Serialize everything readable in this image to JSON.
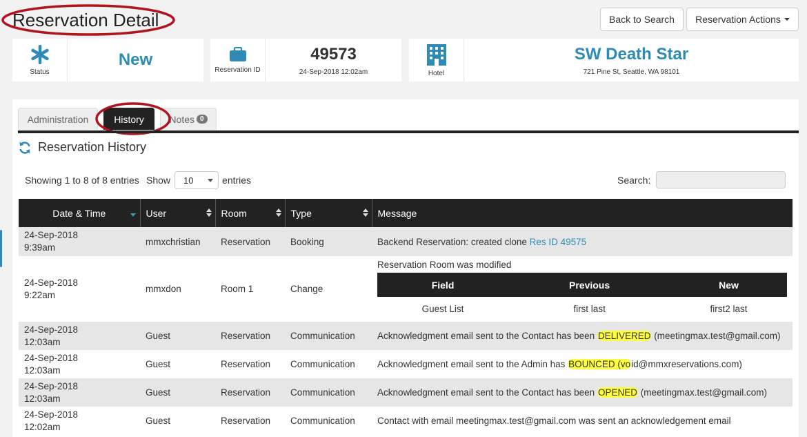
{
  "header": {
    "title": "Reservation Detail",
    "back_button": "Back to Search",
    "actions_button": "Reservation Actions"
  },
  "summary": {
    "status": {
      "caption": "Status",
      "value": "New",
      "icon": "asterisk-icon"
    },
    "reservation": {
      "caption": "Reservation ID",
      "value": "49573",
      "date": "24-Sep-2018 12:02am",
      "icon": "briefcase-icon"
    },
    "hotel": {
      "caption": "Hotel",
      "value": "SW Death Star",
      "address": "721 Pine St, Seattle, WA 98101",
      "icon": "building-icon"
    }
  },
  "tabs": {
    "administration": "Administration",
    "history": "History",
    "notes": "Notes",
    "notes_count": "0",
    "active": "History"
  },
  "history": {
    "title": "Reservation History",
    "showing": "Showing 1 to 8 of 8 entries",
    "show_label": "Show",
    "page_size": "10",
    "entries_label": "entries",
    "search_label": "Search:",
    "search_value": "",
    "columns": [
      "Date & Time",
      "User",
      "Room",
      "Type",
      "Message"
    ],
    "rows": [
      {
        "date": "24-Sep-2018",
        "time": "9:39am",
        "user": "mmxchristian",
        "room": "Reservation",
        "type": "Booking",
        "message_prefix": "Backend Reservation: created clone ",
        "message_link": "Res ID 49575"
      },
      {
        "date": "24-Sep-2018",
        "time": "9:22am",
        "user": "mmxdon",
        "room": "Room 1",
        "type": "Change",
        "message": "Reservation Room was modified",
        "changes": {
          "headers": [
            "Field",
            "Previous",
            "New"
          ],
          "row": [
            "Guest List",
            "first last",
            "first2 last"
          ]
        }
      },
      {
        "date": "24-Sep-2018",
        "time": "12:03am",
        "user": "Guest",
        "room": "Reservation",
        "type": "Communication",
        "message_prefix": "Acknowledgment email sent to the Contact has been ",
        "message_highlight": "DELIVERED",
        "message_suffix": " (meetingmax.test@gmail.com)"
      },
      {
        "date": "24-Sep-2018",
        "time": "12:03am",
        "user": "Guest",
        "room": "Reservation",
        "type": "Communication",
        "message_prefix": "Acknowledgment email sent to the Admin has ",
        "message_highlight": "BOUNCED (vo",
        "message_suffix": "id@mmxreservations.com)"
      },
      {
        "date": "24-Sep-2018",
        "time": "12:03am",
        "user": "Guest",
        "room": "Reservation",
        "type": "Communication",
        "message_prefix": "Acknowledgment email sent to the Contact has been ",
        "message_highlight": "OPENED",
        "message_suffix": " (meetingmax.test@gmail.com)"
      },
      {
        "date": "24-Sep-2018",
        "time": "12:02am",
        "user": "Guest",
        "room": "Reservation",
        "type": "Communication",
        "message": "Contact with email meetingmax.test@gmail.com was sent an acknowledgement email"
      }
    ]
  },
  "colors": {
    "accent": "#2e8bb5",
    "annotation": "#b0141e",
    "highlight": "#ffff3a",
    "header_dark": "#222222"
  }
}
